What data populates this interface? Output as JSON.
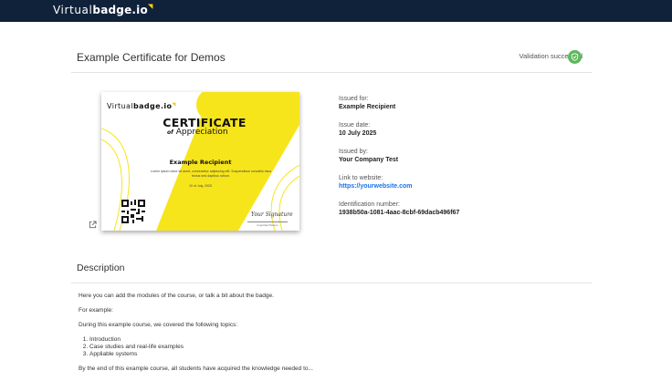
{
  "topbar": {
    "brand_light": "Virtual",
    "brand_bold": "badge.io"
  },
  "header": {
    "title": "Example Certificate for Demos",
    "validation_text": "Validation successful",
    "validation_color": "#5cb85c"
  },
  "certificate": {
    "logo_light": "Virtual",
    "logo_bold": "badge.io",
    "title": "CERTIFICATE",
    "subtitle_small": "of",
    "subtitle": "Appreciation",
    "recipient": "Example Recipient",
    "lorem": "Lorem ipsum dolor sit amet, consectetur adipiscing elit. Suspendisse convallis risus tectus sed dapibus rutrum.",
    "date": "10 of July, 2025",
    "signature": "Your Signature",
    "signature_name": "Important Person",
    "accent_color": "#f7e51c"
  },
  "details": {
    "issued_for_label": "Issued for:",
    "issued_for": "Example Recipient",
    "issue_date_label": "Issue date:",
    "issue_date": "10 July 2025",
    "issued_by_label": "Issued by:",
    "issued_by": "Your Company Test",
    "link_label": "Link to website:",
    "link": "https://yourwebsite.com",
    "link_color": "#1a73e8",
    "id_label": "Identification number:",
    "id": "1938b50a-1081-4aac-8cbf-69dacb496f67"
  },
  "description": {
    "title": "Description",
    "p1": "Here you can add the modules of the course, or talk a bit about the badge.",
    "p2": "For example:",
    "p3": "During this example course, we covered the following topics:",
    "items": [
      "Introduction",
      "Case studies and real-life examples",
      "Appliable systems"
    ],
    "p4": "By the end of this example course, all students have acquired the knowledge needed to..."
  }
}
